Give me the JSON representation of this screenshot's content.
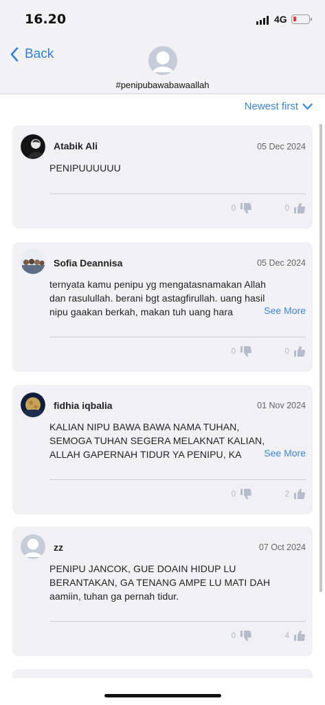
{
  "status": {
    "time": "16.20",
    "network": "4G"
  },
  "nav": {
    "back_label": "Back",
    "title": "#penipubawabawaallah"
  },
  "sort": {
    "label": "Newest first"
  },
  "colors": {
    "accent": "#3a86dc",
    "card_bg": "#f1f1f5",
    "battery_low": "#e53935"
  },
  "comments": [
    {
      "name": "Atabik Ali",
      "date": "05 Dec 2024",
      "lines": [
        "PENIPUUUUUU"
      ],
      "see_more": "",
      "dislikes": "0",
      "likes": "0",
      "avatar": "dark-photo"
    },
    {
      "name": "Sofia Deannisa",
      "date": "05 Dec 2024",
      "lines": [
        "ternyata kamu penipu yg mengatasnamakan Allah",
        "dan rasulullah. berani bgt astagfirullah. uang hasil",
        "nipu gaakan berkah, makan tuh uang hara"
      ],
      "see_more": "See More",
      "dislikes": "0",
      "likes": "0",
      "avatar": "group-photo"
    },
    {
      "name": "fidhia iqbalia",
      "date": "01 Nov 2024",
      "lines": [
        "KALIAN NIPU BAWA BAWA NAMA TUHAN,",
        "SEMOGA TUHAN SEGERA MELAKNAT KALIAN,",
        "ALLAH GAPERNAH TIDUR YA PENIPU, KA"
      ],
      "see_more": "See More",
      "dislikes": "0",
      "likes": "2",
      "avatar": "moon-photo"
    },
    {
      "name": "zz",
      "date": "07 Oct 2024",
      "lines": [
        "PENIPU JANCOK, GUE DOAIN HIDUP LU",
        "BERANTAKAN, GA TENANG AMPE LU MATI DAH",
        "aamiin, tuhan ga pernah tidur."
      ],
      "see_more": "",
      "dislikes": "0",
      "likes": "4",
      "avatar": "default-avatar"
    }
  ]
}
